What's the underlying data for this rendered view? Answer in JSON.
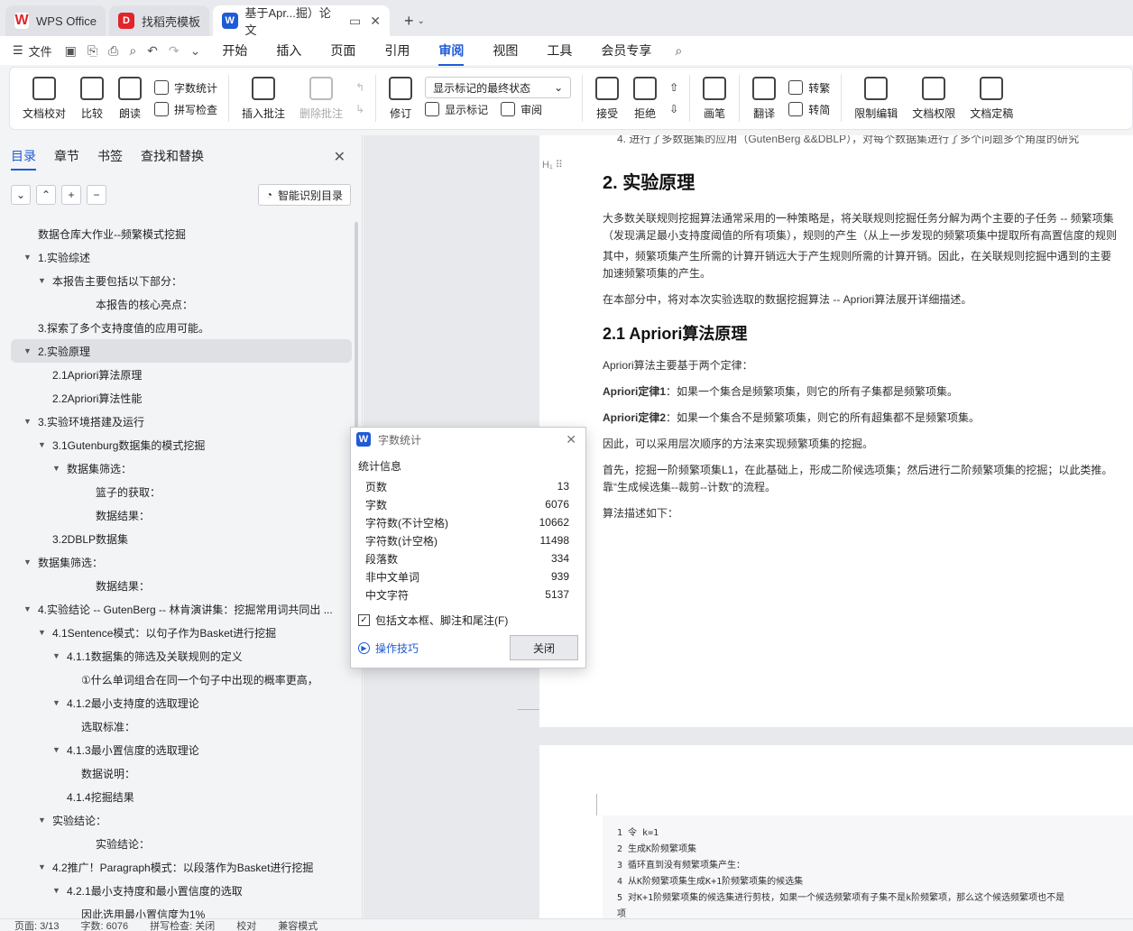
{
  "tabs": [
    {
      "label": "WPS Office",
      "icon": "wps-logo-icon"
    },
    {
      "label": "找稻壳模板",
      "icon": "docer-icon"
    },
    {
      "label": "基于Apr...掘）论文",
      "icon": "word-doc-icon"
    }
  ],
  "menu": {
    "file": "文件",
    "tabs": [
      "开始",
      "插入",
      "页面",
      "引用",
      "审阅",
      "视图",
      "工具",
      "会员专享"
    ],
    "active_tab": "审阅"
  },
  "ribbon": {
    "doc_check": "文档校对",
    "compare": "比较",
    "read_aloud": "朗读",
    "word_count": "字数统计",
    "spell_check": "拼写检查",
    "insert_comment": "插入批注",
    "delete_comment": "删除批注",
    "revise": "修订",
    "markup_select": "显示标记的最终状态",
    "show_markup": "显示标记",
    "review": "审阅",
    "accept": "接受",
    "reject": "拒绝",
    "pen": "画笔",
    "translate": "翻译",
    "to_trad": "转繁",
    "to_simp": "转简",
    "restrict": "限制编辑",
    "permission": "文档权限",
    "finalize": "文档定稿"
  },
  "left_panel": {
    "tabs": [
      "目录",
      "章节",
      "书签",
      "查找和替换"
    ],
    "smart_toc": "智能识别目录",
    "toc": [
      {
        "text": "数据仓库大作业--频繁模式挖掘",
        "level": 0,
        "arrow": false
      },
      {
        "text": "1.实验综述",
        "level": 0,
        "arrow": true
      },
      {
        "text": "本报告主要包括以下部分：",
        "level": 1,
        "arrow": true
      },
      {
        "text": "本报告的核心亮点：",
        "level": 4,
        "arrow": false
      },
      {
        "text": "3.探索了多个支持度值的应用可能。",
        "level": 0,
        "arrow": false
      },
      {
        "text": "2.实验原理",
        "level": 0,
        "arrow": true,
        "selected": true
      },
      {
        "text": "2.1Apriori算法原理",
        "level": 1,
        "arrow": false
      },
      {
        "text": "2.2Apriori算法性能",
        "level": 1,
        "arrow": false
      },
      {
        "text": "3.实验环境搭建及运行",
        "level": 0,
        "arrow": true
      },
      {
        "text": "3.1Gutenburg数据集的模式挖掘",
        "level": 1,
        "arrow": true
      },
      {
        "text": "数据集筛选：",
        "level": 2,
        "arrow": true
      },
      {
        "text": "篮子的获取：",
        "level": 4,
        "arrow": false
      },
      {
        "text": "数据结果：",
        "level": 4,
        "arrow": false
      },
      {
        "text": "3.2DBLP数据集",
        "level": 1,
        "arrow": false
      },
      {
        "text": "数据集筛选：",
        "level": 0,
        "arrow": true
      },
      {
        "text": "数据结果：",
        "level": 4,
        "arrow": false
      },
      {
        "text": "4.实验结论 -- GutenBerg -- 林肯演讲集：挖掘常用词共同出 ...",
        "level": 0,
        "arrow": true
      },
      {
        "text": "4.1Sentence模式：以句子作为Basket进行挖掘",
        "level": 1,
        "arrow": true
      },
      {
        "text": "4.1.1数据集的筛选及关联规则的定义",
        "level": 2,
        "arrow": true
      },
      {
        "text": "①什么单词组合在同一个句子中出现的概率更高，",
        "level": 3,
        "arrow": false
      },
      {
        "text": "4.1.2最小支持度的选取理论",
        "level": 2,
        "arrow": true
      },
      {
        "text": "选取标准：",
        "level": 3,
        "arrow": false
      },
      {
        "text": "4.1.3最小置信度的选取理论",
        "level": 2,
        "arrow": true
      },
      {
        "text": "数据说明：",
        "level": 3,
        "arrow": false
      },
      {
        "text": "4.1.4挖掘结果",
        "level": 2,
        "arrow": false
      },
      {
        "text": "实验结论：",
        "level": 1,
        "arrow": true
      },
      {
        "text": "实验结论：",
        "level": 4,
        "arrow": false
      },
      {
        "text": "4.2推广！Paragraph模式：以段落作为Basket进行挖掘",
        "level": 1,
        "arrow": true
      },
      {
        "text": "4.2.1最小支持度和最小置信度的选取",
        "level": 2,
        "arrow": true
      },
      {
        "text": "因此选用最小置信度为1%",
        "level": 3,
        "arrow": false
      }
    ]
  },
  "document": {
    "top_line": "4. 进行了多数据集的应用（GutenBerg &&DBLP），对每个数据集进行了多个问题多个角度的研究",
    "h2": "2. 实验原理",
    "p1a": "大多数关联规则挖掘算法通常采用的一种策略是，将关联规则挖掘任务分解为两个主要的子任务 -- 频繁项集",
    "p1b": "（发现满足最小支持度阈值的所有项集），规则的产生（从上一步发现的频繁项集中提取所有高置信度的规则",
    "p2a": "其中，频繁项集产生所需的计算开销远大于产生规则所需的计算开销。因此，在关联规则挖掘中遇到的主要",
    "p2b": "加速频繁项集的产生。",
    "p3": "在本部分中，将对本次实验选取的数据挖掘算法 -- Apriori算法展开详细描述。",
    "h3": "2.1 Apriori算法原理",
    "p4": "Apriori算法主要基于两个定律：",
    "law1_label": "Apriori定律1",
    "law1_text": "：如果一个集合是频繁项集，则它的所有子集都是频繁项集。",
    "law2_label": "Apriori定律2",
    "law2_text": "：如果一个集合不是频繁项集，则它的所有超集都不是频繁项集。",
    "p5": "因此，可以采用层次顺序的方法来实现频繁项集的挖掘。",
    "p6a": "首先，挖掘一阶频繁项集L1，在此基础上，形成二阶候选项集；然后进行二阶频繁项集的挖掘；以此类推。",
    "p6b": "靠“生成候选集--裁剪--计数”的流程。",
    "p7": "算法描述如下：",
    "code": [
      "1 令 k=1",
      "2 生成K阶频繁项集",
      "3 循环直到没有频繁项集产生：",
      "4    从K阶频繁项集生成K+1阶频繁项集的候选集",
      "5    对K+1阶频繁项集的候选集进行剪枝，如果一个候选频繁项有子集不是k阶频繁项，那么这个候选频繁项也不是",
      "项"
    ]
  },
  "dialog": {
    "title": "字数统计",
    "section": "统计信息",
    "rows": [
      {
        "label": "页数",
        "value": "13"
      },
      {
        "label": "字数",
        "value": "6076"
      },
      {
        "label": "字符数(不计空格)",
        "value": "10662"
      },
      {
        "label": "字符数(计空格)",
        "value": "11498"
      },
      {
        "label": "段落数",
        "value": "334"
      },
      {
        "label": "非中文单词",
        "value": "939"
      },
      {
        "label": "中文字符",
        "value": "5137"
      }
    ],
    "checkbox": "包括文本框、脚注和尾注(F)",
    "tips": "操作技巧",
    "close": "关闭"
  },
  "status": {
    "page": "页面: 3/13",
    "words": "字数: 6076",
    "spell": "拼写检查: 关闭",
    "proof": "校对",
    "compat": "兼容模式"
  }
}
